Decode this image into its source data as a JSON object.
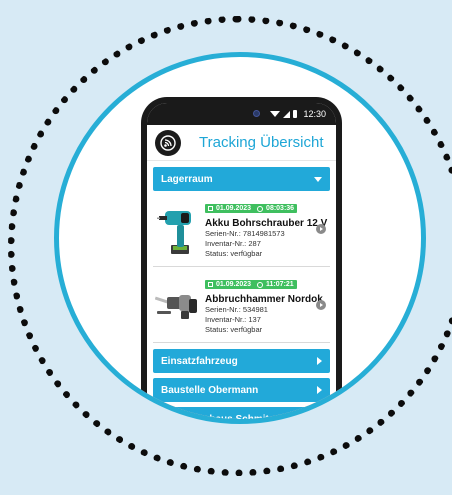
{
  "statusbar": {
    "time": "12:30"
  },
  "header": {
    "title": "Tracking Übersicht",
    "logo_icon": "tracking-signal-icon"
  },
  "sections": [
    {
      "label": "Lagerraum",
      "expanded": true,
      "items": [
        {
          "date": "01.09.2023",
          "time": "08:03:36",
          "name": "Akku Bohrschrauber 12 V",
          "serial": "Serien-Nr.: 7814981573",
          "inventory": "Inventar-Nr.: 287",
          "status": "Status: verfügbar",
          "image_icon": "cordless-drill-image"
        },
        {
          "date": "01.09.2023",
          "time": "11:07:21",
          "name": "Abbruchhammer Nordok",
          "serial": "Serien-Nr.: 534981",
          "inventory": "Inventar-Nr.: 137",
          "status": "Status: verfügbar",
          "image_icon": "demolition-hammer-image"
        }
      ]
    },
    {
      "label": "Einsatzfahrzeug",
      "expanded": false
    },
    {
      "label": "Baustelle Obermann",
      "expanded": false
    },
    {
      "label": "Geschäftshaus Schmitz",
      "expanded": false
    }
  ],
  "colors": {
    "accent": "#22a9d9",
    "badge": "#3fbf5f",
    "background": "#d7eaf5",
    "ring": "#27aed6"
  }
}
